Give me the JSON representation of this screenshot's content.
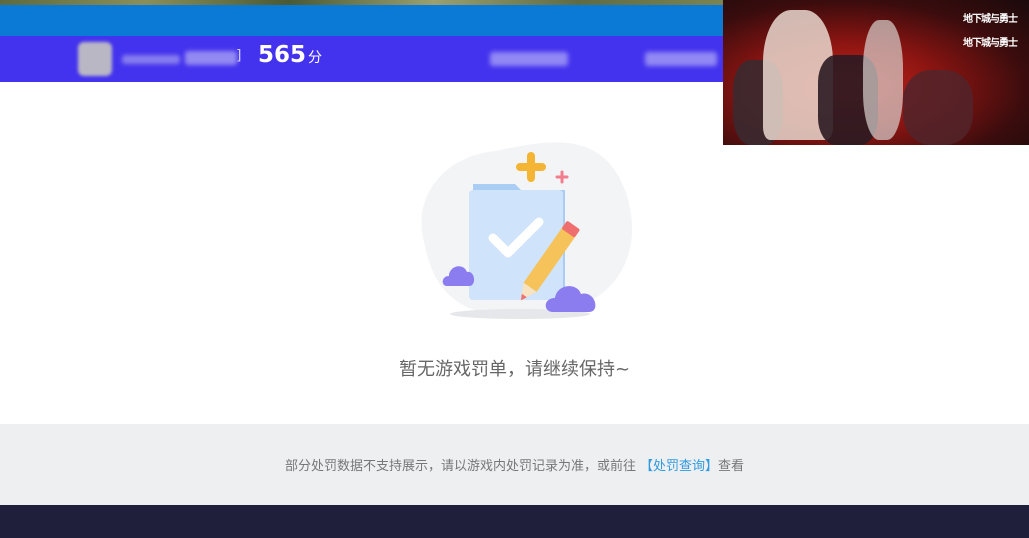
{
  "user": {
    "score_value": "565",
    "score_unit": "分",
    "bracket_close": "]"
  },
  "ad": {
    "logo_line1": "地下城与勇士",
    "logo_line2": "地下城与勇士"
  },
  "empty_state": {
    "message": "暂无游戏罚单，请继续保持~"
  },
  "notice": {
    "text": "部分处罚数据不支持展示，请以游戏内处罚记录为准，或前往",
    "link_label": "【处罚查询】",
    "tail": "查看"
  },
  "colors": {
    "blue_bar": "#0a7ad6",
    "user_bar": "#4433ee",
    "link": "#2f9be0",
    "footer": "#1f1f3c"
  }
}
